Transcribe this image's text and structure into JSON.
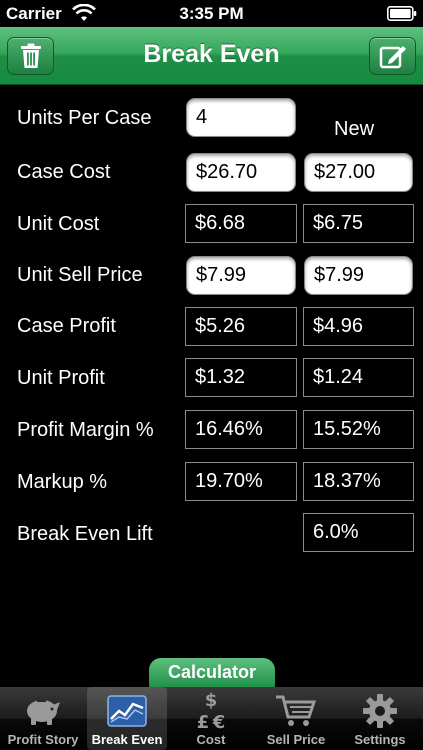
{
  "status": {
    "carrier": "Carrier",
    "time": "3:35 PM"
  },
  "nav": {
    "title": "Break Even"
  },
  "columns": {
    "new_header": "New"
  },
  "rows": [
    {
      "label": "Units Per Case",
      "current": "4",
      "new": null
    },
    {
      "label": "Case Cost",
      "current": "$26.70",
      "new": "$27.00"
    },
    {
      "label": "Unit Cost",
      "current": "$6.68",
      "new": "$6.75"
    },
    {
      "label": "Unit Sell Price",
      "current": "$7.99",
      "new": "$7.99"
    },
    {
      "label": "Case Profit",
      "current": "$5.26",
      "new": "$4.96"
    },
    {
      "label": "Unit Profit",
      "current": "$1.32",
      "new": "$1.24"
    },
    {
      "label": "Profit Margin %",
      "current": "16.46%",
      "new": "15.52%"
    },
    {
      "label": "Markup %",
      "current": "19.70%",
      "new": "18.37%"
    },
    {
      "label": "Break Even Lift",
      "current": null,
      "new": "6.0%"
    }
  ],
  "calculator_tab": "Calculator",
  "tabs": [
    {
      "label": "Profit Story",
      "icon": "piggy-bank-icon"
    },
    {
      "label": "Break Even",
      "icon": "line-chart-icon",
      "active": true
    },
    {
      "label": "Cost",
      "icon": "currency-icon"
    },
    {
      "label": "Sell Price",
      "icon": "shopping-cart-icon"
    },
    {
      "label": "Settings",
      "icon": "gear-icon"
    }
  ],
  "colors": {
    "accent_green": "#1f8f47",
    "background": "#000000"
  }
}
